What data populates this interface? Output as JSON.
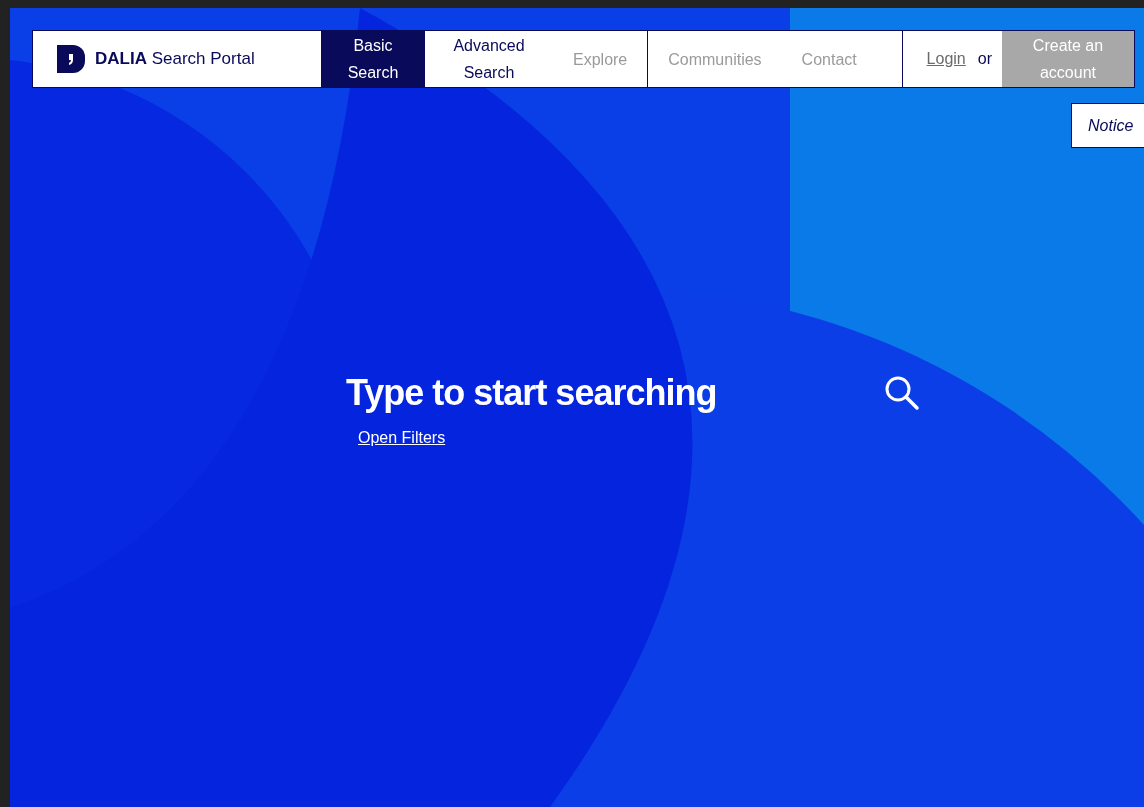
{
  "brand": {
    "bold": "DALIA",
    "rest": "Search Portal"
  },
  "nav_groups": [
    {
      "items": [
        {
          "label": "Basic Search",
          "selected": true,
          "disabled": false
        },
        {
          "label": "Advanced Search",
          "selected": false,
          "disabled": false
        },
        {
          "label": "Explore",
          "selected": false,
          "disabled": true
        }
      ]
    },
    {
      "items": [
        {
          "label": "Communities",
          "selected": false,
          "disabled": true
        },
        {
          "label": "Contact",
          "selected": false,
          "disabled": true
        }
      ]
    }
  ],
  "account": {
    "login": "Login",
    "separator": "or",
    "create": "Create an account",
    "create_disabled": true
  },
  "notice_field": {
    "placeholder": "Notice"
  },
  "search": {
    "placeholder": "Type to start searching",
    "filters_link": "Open Filters"
  }
}
